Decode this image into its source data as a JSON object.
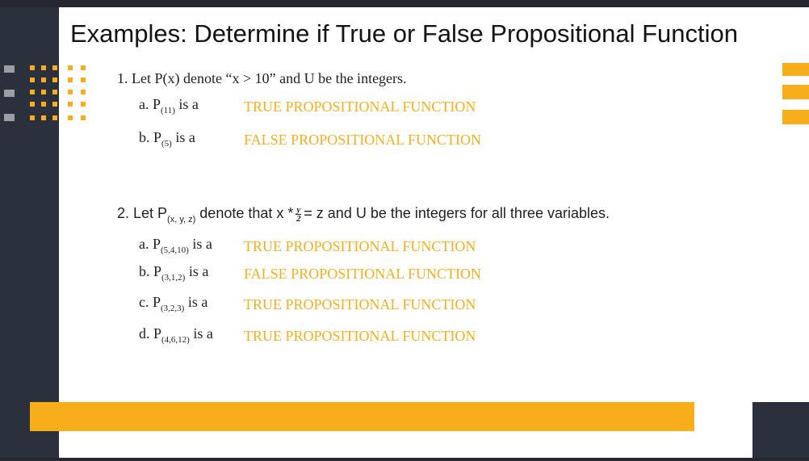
{
  "title": "Examples: Determine if True or False Propositional Function",
  "example1": {
    "intro": "1. Let P(x) denote “x > 10” and U be the integers.",
    "items": [
      {
        "prefix": "a. P",
        "sub": "(11)",
        "suffix": "is a",
        "answer": "TRUE PROPOSITIONAL FUNCTION"
      },
      {
        "prefix": "b. P",
        "sub": "(5)",
        "suffix": "is a",
        "answer": "FALSE PROPOSITIONAL FUNCTION"
      }
    ]
  },
  "example2": {
    "intro_pre": "2. Let P",
    "intro_sub": "(x, y, z)",
    "intro_mid": "denote that x *",
    "frac_num": "y",
    "frac_den": "2",
    "intro_post": "= z and U be the integers for all three variables.",
    "items": [
      {
        "prefix": "a. P",
        "sub": "(5,4,10)",
        "suffix": "is a",
        "answer": "TRUE PROPOSITIONAL FUNCTION"
      },
      {
        "prefix": "b. P",
        "sub": "(3,1,2)",
        "suffix": "is a",
        "answer": "FALSE PROPOSITIONAL FUNCTION"
      },
      {
        "prefix": "c. P",
        "sub": "(3,2,3)",
        "suffix": "is a",
        "answer": "TRUE PROPOSITIONAL FUNCTION"
      },
      {
        "prefix": "d. P",
        "sub": "(4,6,12)",
        "suffix": "is a",
        "answer": "TRUE PROPOSITIONAL FUNCTION"
      }
    ]
  },
  "colors": {
    "accent": "#f8ae1a",
    "dark": "#2b303d",
    "text": "#1f1f1f"
  }
}
